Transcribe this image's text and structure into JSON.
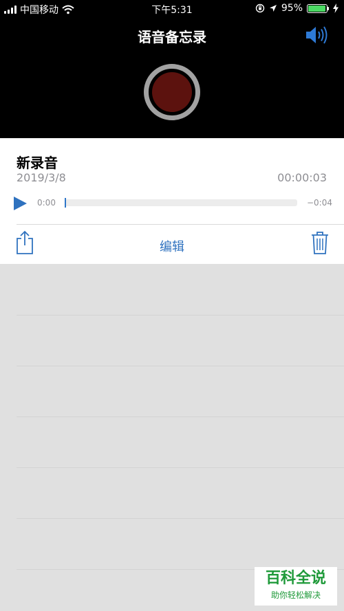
{
  "status": {
    "carrier": "中国移动",
    "time": "下午5:31",
    "battery": "95%",
    "battery_level": 0.95,
    "icons": [
      "signal-icon",
      "wifi-icon",
      "orientation-lock-icon",
      "location-icon",
      "battery-icon",
      "charging-icon"
    ]
  },
  "header": {
    "title": "语音备忘录",
    "speaker_icon": "speaker-icon",
    "record_icon": "record-icon"
  },
  "recording": {
    "name": "新录音",
    "date": "2019/3/8",
    "duration": "00:00:03",
    "time_start": "0:00",
    "time_end": "−0:04",
    "progress": 0.0
  },
  "actions": {
    "share_icon": "share-icon",
    "edit_label": "编辑",
    "trash_icon": "trash-icon"
  },
  "watermark": {
    "main": "百科全说",
    "sub": "助你轻松解决"
  },
  "colors": {
    "accent": "#2f72bf",
    "record": "#5c120e",
    "battery": "#4cd964",
    "watermark": "#1f9a3a"
  }
}
